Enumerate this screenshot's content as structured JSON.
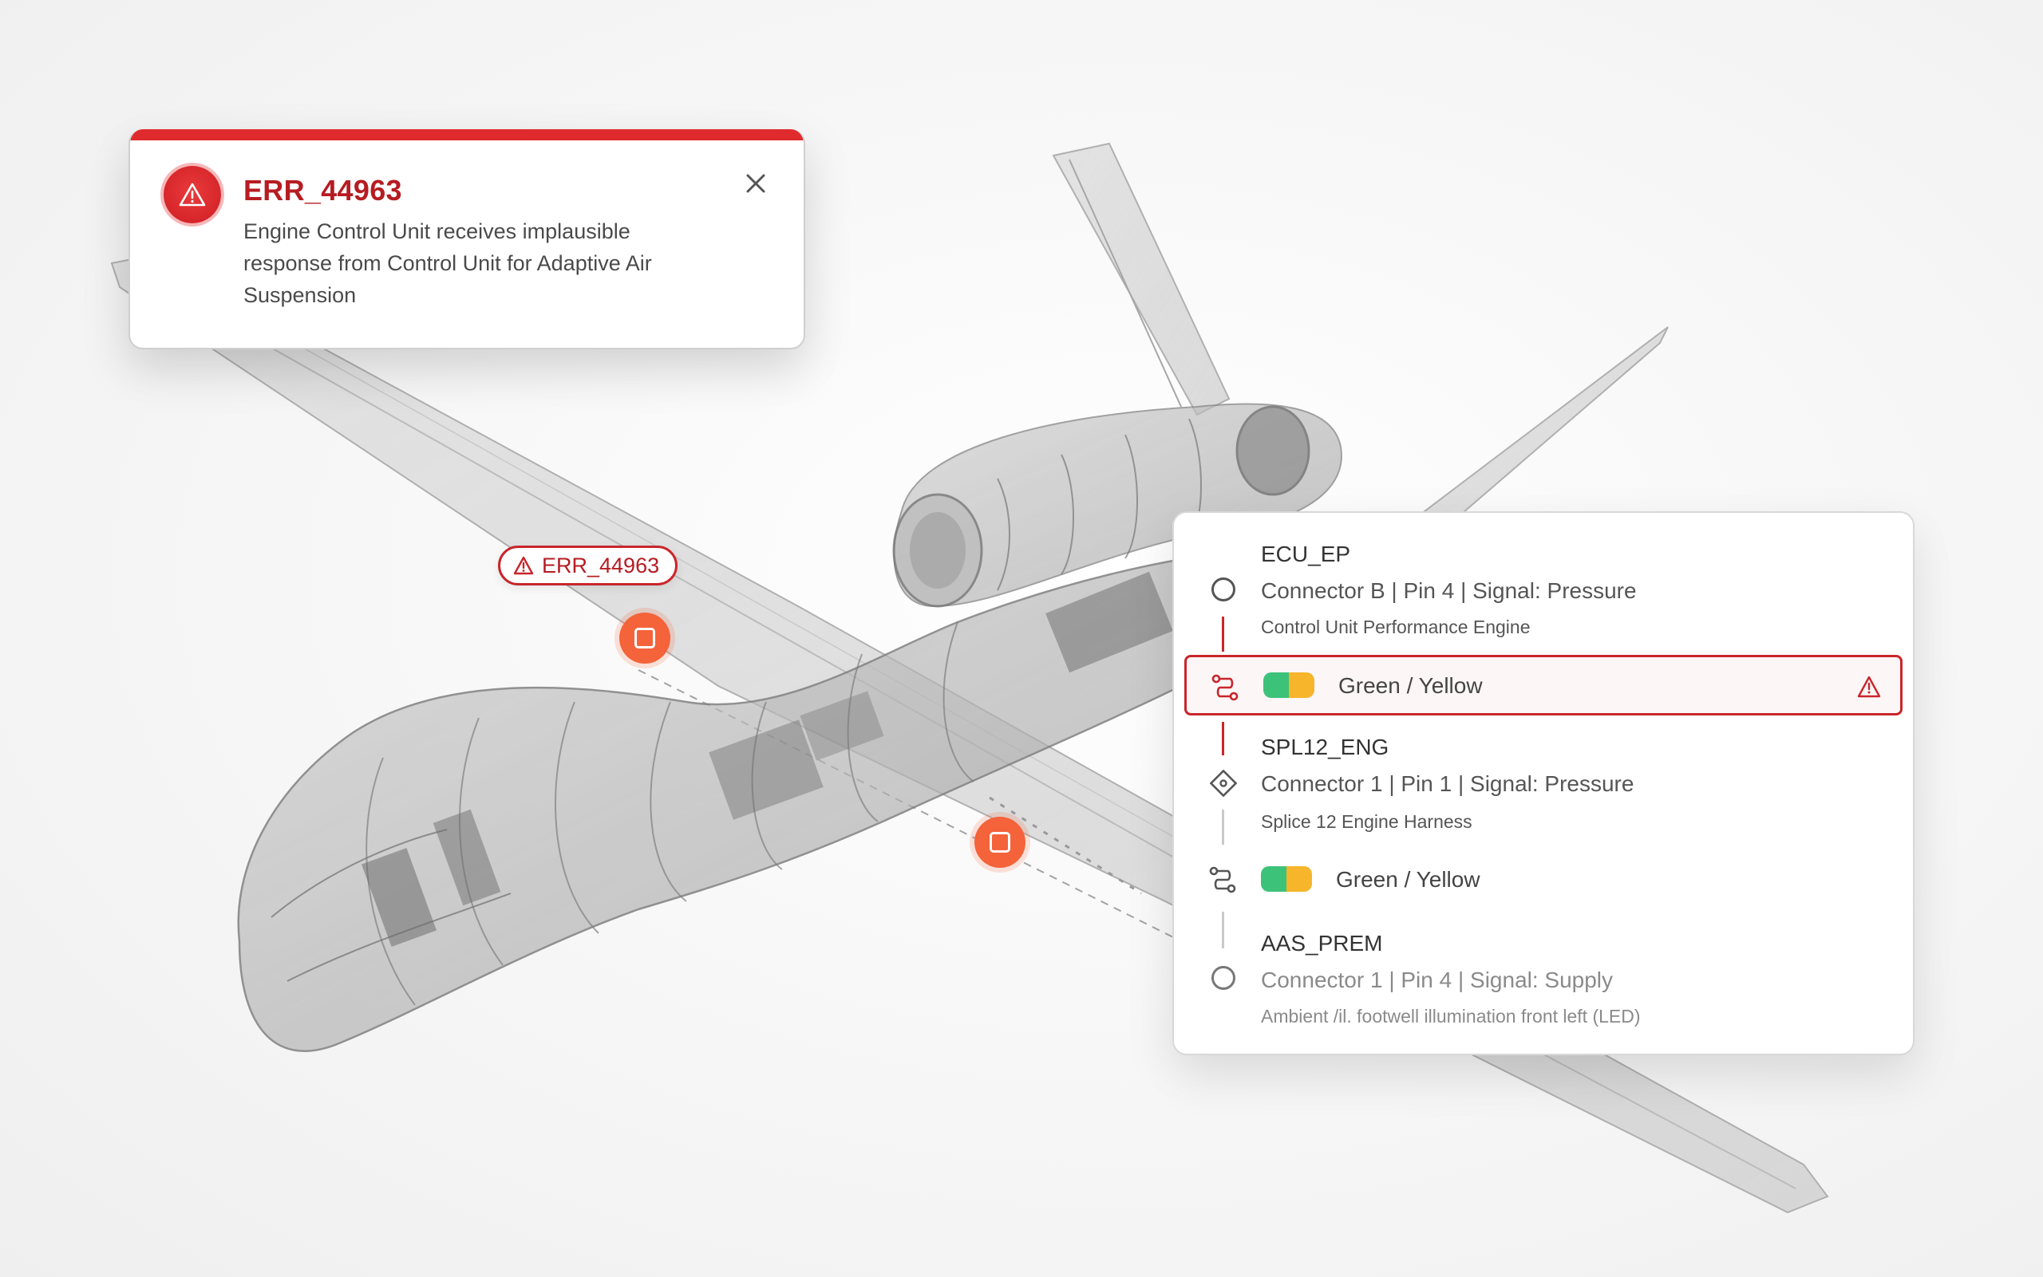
{
  "colors": {
    "error_red": "#e02b2e",
    "error_text": "#b61c22",
    "hotspot_orange": "#f4633a",
    "wire_green": "#3dc27a",
    "wire_yellow": "#f7b52b"
  },
  "error_popup": {
    "icon": "warning-triangle-icon",
    "code": "ERR_44963",
    "message": "Engine Control Unit receives implausible response from Control Unit for Adaptive Air Suspension",
    "close_icon": "close-icon"
  },
  "model_tag": {
    "icon": "warning-triangle-icon",
    "label": "ERR_44963"
  },
  "hotspots": [
    {
      "icon": "square-icon"
    },
    {
      "icon": "square-icon"
    }
  ],
  "circuit": {
    "components": [
      {
        "name": "ECU_EP",
        "detail": "Connector B | Pin 4 | Signal: Pressure",
        "description": "Control Unit Performance Engine",
        "icon": "circle-node-icon"
      },
      {
        "name": "SPL12_ENG",
        "detail": "Connector 1 | Pin 1 | Signal: Pressure",
        "description": "Splice 12 Engine Harness",
        "icon": "splice-diamond-icon"
      },
      {
        "name": "AAS_PREM",
        "detail": "Connector 1 | Pin 4 | Signal: Supply",
        "description": "Ambient /il. footwell illumination front left (LED)",
        "icon": "circle-node-icon"
      }
    ],
    "wires": [
      {
        "label": "Green / Yellow",
        "icon": "wire-route-icon",
        "alert": true,
        "alert_icon": "warning-triangle-icon"
      },
      {
        "label": "Green / Yellow",
        "icon": "wire-route-icon",
        "alert": false
      }
    ]
  }
}
